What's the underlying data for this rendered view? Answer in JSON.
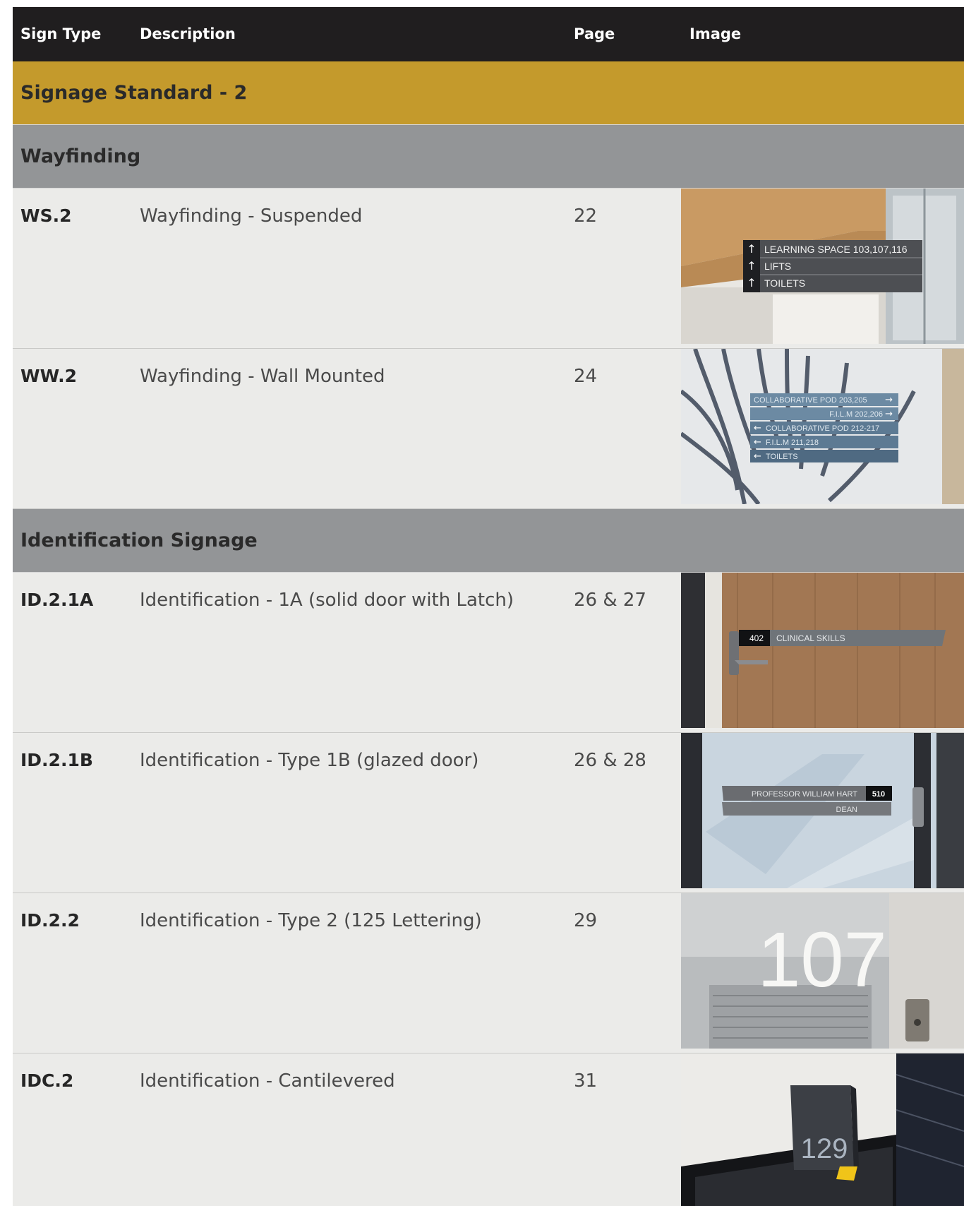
{
  "columns": {
    "sign_type": "Sign Type",
    "description": "Description",
    "page": "Page",
    "image": "Image"
  },
  "section_title": "Signage Standard - 2",
  "groups": [
    {
      "title": "Wayfinding",
      "items": [
        {
          "code": "WS.2",
          "description": "Wayfinding - Suspended",
          "page": "22",
          "image_text": [
            "LEARNING SPACE 103,107,116",
            "LIFTS",
            "TOILETS"
          ]
        },
        {
          "code": "WW.2",
          "description": "Wayfinding - Wall Mounted",
          "page": "24",
          "image_text": [
            "COLLABORATIVE POD 203,205",
            "F.I.L.M 202,206",
            "COLLABORATIVE POD 212-217",
            "F.I.L.M 211,218",
            "TOILETS"
          ]
        }
      ]
    },
    {
      "title": "Identification Signage",
      "items": [
        {
          "code": "ID.2.1A",
          "description": "Identification - 1A (solid door with Latch)",
          "page": "26 & 27",
          "image_text": [
            "402",
            "CLINICAL SKILLS"
          ]
        },
        {
          "code": "ID.2.1B",
          "description": "Identification - Type 1B (glazed door)",
          "page": "26 & 28",
          "image_text": [
            "PROFESSOR WILLIAM HART",
            "510",
            "DEAN"
          ]
        },
        {
          "code": "ID.2.2",
          "description": "Identification - Type 2 (125 Lettering)",
          "page": "29",
          "image_text": [
            "107"
          ]
        },
        {
          "code": "IDC.2",
          "description": "Identification - Cantilevered",
          "page": "31",
          "image_text": [
            "129"
          ]
        }
      ]
    }
  ]
}
